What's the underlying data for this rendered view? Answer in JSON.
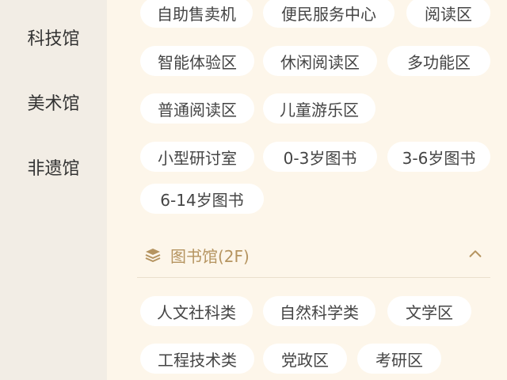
{
  "sidebar": {
    "items": [
      {
        "label": "科技馆"
      },
      {
        "label": "美术馆"
      },
      {
        "label": "非遗馆"
      }
    ]
  },
  "section_prev": {
    "chips": [
      "自助售卖机",
      "便民服务中心",
      "阅读区",
      "智能体验区",
      "休闲阅读区",
      "多功能区",
      "普通阅读区",
      "儿童游乐区",
      "小型研讨室",
      "0-3岁图书",
      "3-6岁图书",
      "6-14岁图书"
    ]
  },
  "section_library": {
    "title": "图书馆(2F)",
    "icon": "books-stack-icon",
    "expanded": true,
    "chips": [
      "人文社科类",
      "自然科学类",
      "文学区",
      "工程技术类",
      "党政区",
      "考研区"
    ]
  },
  "colors": {
    "accent": "#b59460",
    "chip_bg": "#ffffff",
    "main_bg": "#fdf6ea",
    "sidebar_bg": "#f2ede5"
  }
}
